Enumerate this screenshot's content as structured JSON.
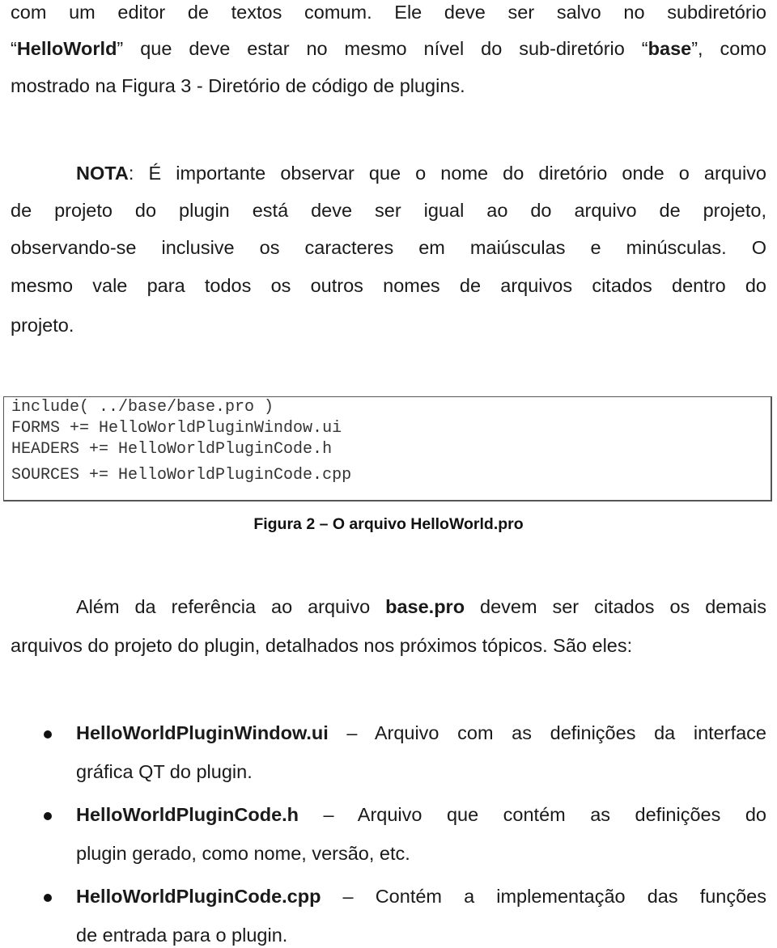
{
  "paragraph_intro": {
    "line1": "com um editor de textos comum. Ele deve ser salvo no subdiretório",
    "line2_open_quote": "“",
    "line2_bold1": "HelloWorld",
    "line2_mid": "” que deve estar no mesmo nível do sub-diretório “",
    "line2_bold2": "base",
    "line2_end": "”, como",
    "line3": "mostrado na Figura 3 - Diretório de código de plugins."
  },
  "note": {
    "label": "NOTA",
    "line1_rest": ": É importante observar que o nome do diretório onde o arquivo",
    "line2": "de projeto do plugin está deve ser igual ao do arquivo de projeto,",
    "line3": "observando-se inclusive os caracteres em maiúsculas e minúsculas. O",
    "line4": "mesmo vale para todos os outros nomes de arquivos citados dentro do",
    "line5": "projeto."
  },
  "code_listing": {
    "lines": [
      "include( ../base/base.pro )",
      "FORMS += HelloWorldPluginWindow.ui",
      "HEADERS += HelloWorldPluginCode.h",
      "SOURCES += HelloWorldPluginCode.cpp"
    ]
  },
  "figure_caption": "Figura 2 – O arquivo HelloWorld.pro",
  "paragraph_files": {
    "line1_pre": "Além da referência ao arquivo ",
    "line1_bold": "base.pro",
    "line1_post": " devem ser citados os demais",
    "line2": "arquivos do projeto do plugin, detalhados nos próximos tópicos. São eles:"
  },
  "file_list": [
    {
      "name": "HelloWorldPluginWindow.ui",
      "desc_line1": " – Arquivo com as definições da interface",
      "desc_line2": "gráfica QT do plugin."
    },
    {
      "name": "HelloWorldPluginCode.h",
      "desc_line1": " – Arquivo que contém as definições do",
      "desc_line2": "plugin gerado, como nome, versão, etc."
    },
    {
      "name": "HelloWorldPluginCode.cpp",
      "desc_line1": " – Contém a implementação das funções",
      "desc_line2": "de entrada para o plugin."
    }
  ]
}
